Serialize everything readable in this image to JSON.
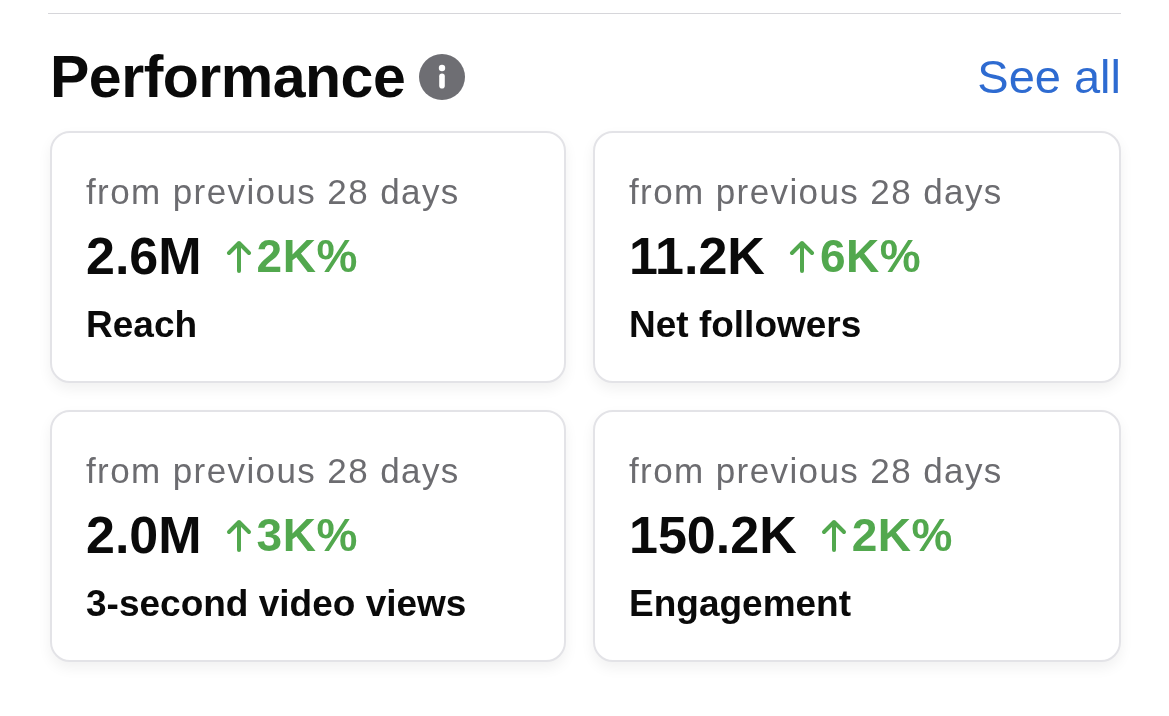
{
  "section": {
    "title": "Performance",
    "link": "See all"
  },
  "cards": [
    {
      "period": "from previous 28 days",
      "value": "2.6M",
      "rising": true,
      "change": "2K%",
      "label": "Reach"
    },
    {
      "period": "from previous 28 days",
      "value": "11.2K",
      "rising": true,
      "change": "6K%",
      "label": "Net followers"
    },
    {
      "period": "from previous 28 days",
      "value": "2.0M",
      "rising": true,
      "change": "3K%",
      "label": "3-second video views"
    },
    {
      "period": "from previous 28 days",
      "value": "150.2K",
      "rising": true,
      "change": "2K%",
      "label": "Engagement"
    }
  ]
}
